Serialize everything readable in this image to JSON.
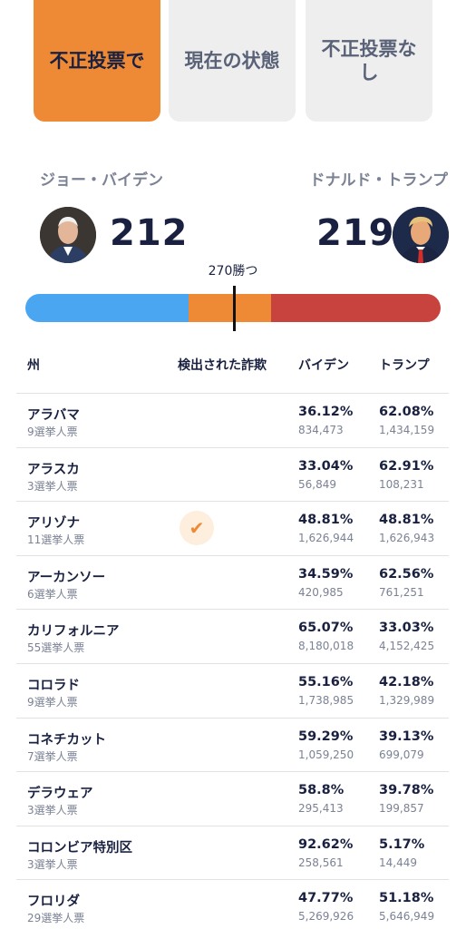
{
  "tabs": [
    {
      "label": "不正投票で",
      "active": true
    },
    {
      "label": "現在の状態",
      "active": false
    },
    {
      "label": "不正投票なし",
      "active": false
    }
  ],
  "candidates": {
    "biden": {
      "name": "ジョー・バイデン",
      "votes": "212"
    },
    "trump": {
      "name": "ドナルド・トランプ",
      "votes": "219"
    }
  },
  "win_label": "270勝つ",
  "headers": {
    "state": "州",
    "fraud": "検出された詐欺",
    "biden": "バイデン",
    "trump": "トランプ"
  },
  "rows": [
    {
      "state": "アラバマ",
      "electoral": "9選挙人票",
      "fraud": false,
      "biden_pct": "36.12%",
      "biden_votes": "834,473",
      "trump_pct": "62.08%",
      "trump_votes": "1,434,159"
    },
    {
      "state": "アラスカ",
      "electoral": "3選挙人票",
      "fraud": false,
      "biden_pct": "33.04%",
      "biden_votes": "56,849",
      "trump_pct": "62.91%",
      "trump_votes": "108,231"
    },
    {
      "state": "アリゾナ",
      "electoral": "11選挙人票",
      "fraud": true,
      "biden_pct": "48.81%",
      "biden_votes": "1,626,944",
      "trump_pct": "48.81%",
      "trump_votes": "1,626,943"
    },
    {
      "state": "アーカンソー",
      "electoral": "6選挙人票",
      "fraud": false,
      "biden_pct": "34.59%",
      "biden_votes": "420,985",
      "trump_pct": "62.56%",
      "trump_votes": "761,251"
    },
    {
      "state": "カリフォルニア",
      "electoral": "55選挙人票",
      "fraud": false,
      "biden_pct": "65.07%",
      "biden_votes": "8,180,018",
      "trump_pct": "33.03%",
      "trump_votes": "4,152,425"
    },
    {
      "state": "コロラド",
      "electoral": "9選挙人票",
      "fraud": false,
      "biden_pct": "55.16%",
      "biden_votes": "1,738,985",
      "trump_pct": "42.18%",
      "trump_votes": "1,329,989"
    },
    {
      "state": "コネチカット",
      "electoral": "7選挙人票",
      "fraud": false,
      "biden_pct": "59.29%",
      "biden_votes": "1,059,250",
      "trump_pct": "39.13%",
      "trump_votes": "699,079"
    },
    {
      "state": "デラウェア",
      "electoral": "3選挙人票",
      "fraud": false,
      "biden_pct": "58.8%",
      "biden_votes": "295,413",
      "trump_pct": "39.78%",
      "trump_votes": "199,857"
    },
    {
      "state": "コロンビア特別区",
      "electoral": "3選挙人票",
      "fraud": false,
      "biden_pct": "92.62%",
      "biden_votes": "258,561",
      "trump_pct": "5.17%",
      "trump_votes": "14,449"
    },
    {
      "state": "フロリダ",
      "electoral": "29選挙人票",
      "fraud": false,
      "biden_pct": "47.77%",
      "biden_votes": "5,269,926",
      "trump_pct": "51.18%",
      "trump_votes": "5,646,949"
    }
  ],
  "fraud_icon": "check-icon",
  "colors": {
    "accent": "#ee8a36",
    "biden": "#4aa6f0",
    "trump": "#c8433e",
    "text": "#1a2140",
    "muted": "#7b8294"
  }
}
